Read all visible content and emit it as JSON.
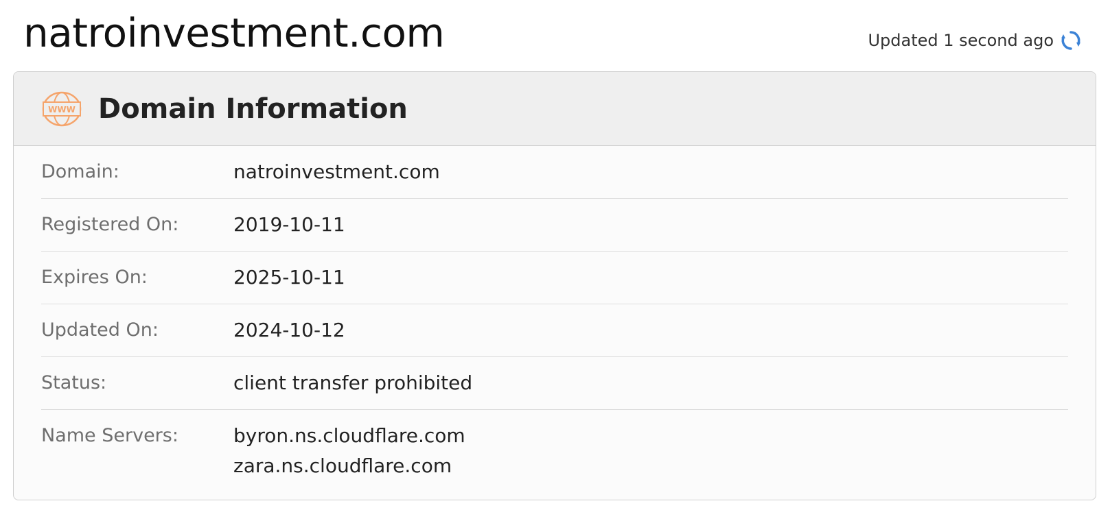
{
  "page": {
    "title": "natroinvestment.com",
    "updated_text": "Updated 1 second ago"
  },
  "card": {
    "title": "Domain Information",
    "icon": "www-globe-icon",
    "accent_color": "#f5a46b",
    "rows": [
      {
        "label": "Domain:",
        "value": "natroinvestment.com"
      },
      {
        "label": "Registered On:",
        "value": "2019-10-11"
      },
      {
        "label": "Expires On:",
        "value": "2025-10-11"
      },
      {
        "label": "Updated On:",
        "value": "2024-10-12"
      },
      {
        "label": "Status:",
        "value": "client transfer prohibited"
      },
      {
        "label": "Name Servers:",
        "values": [
          "byron.ns.cloudflare.com",
          "zara.ns.cloudflare.com"
        ]
      }
    ]
  },
  "colors": {
    "refresh_icon": "#3b82d6",
    "header_bg": "#efefef",
    "label_text": "#6e6e6e"
  }
}
